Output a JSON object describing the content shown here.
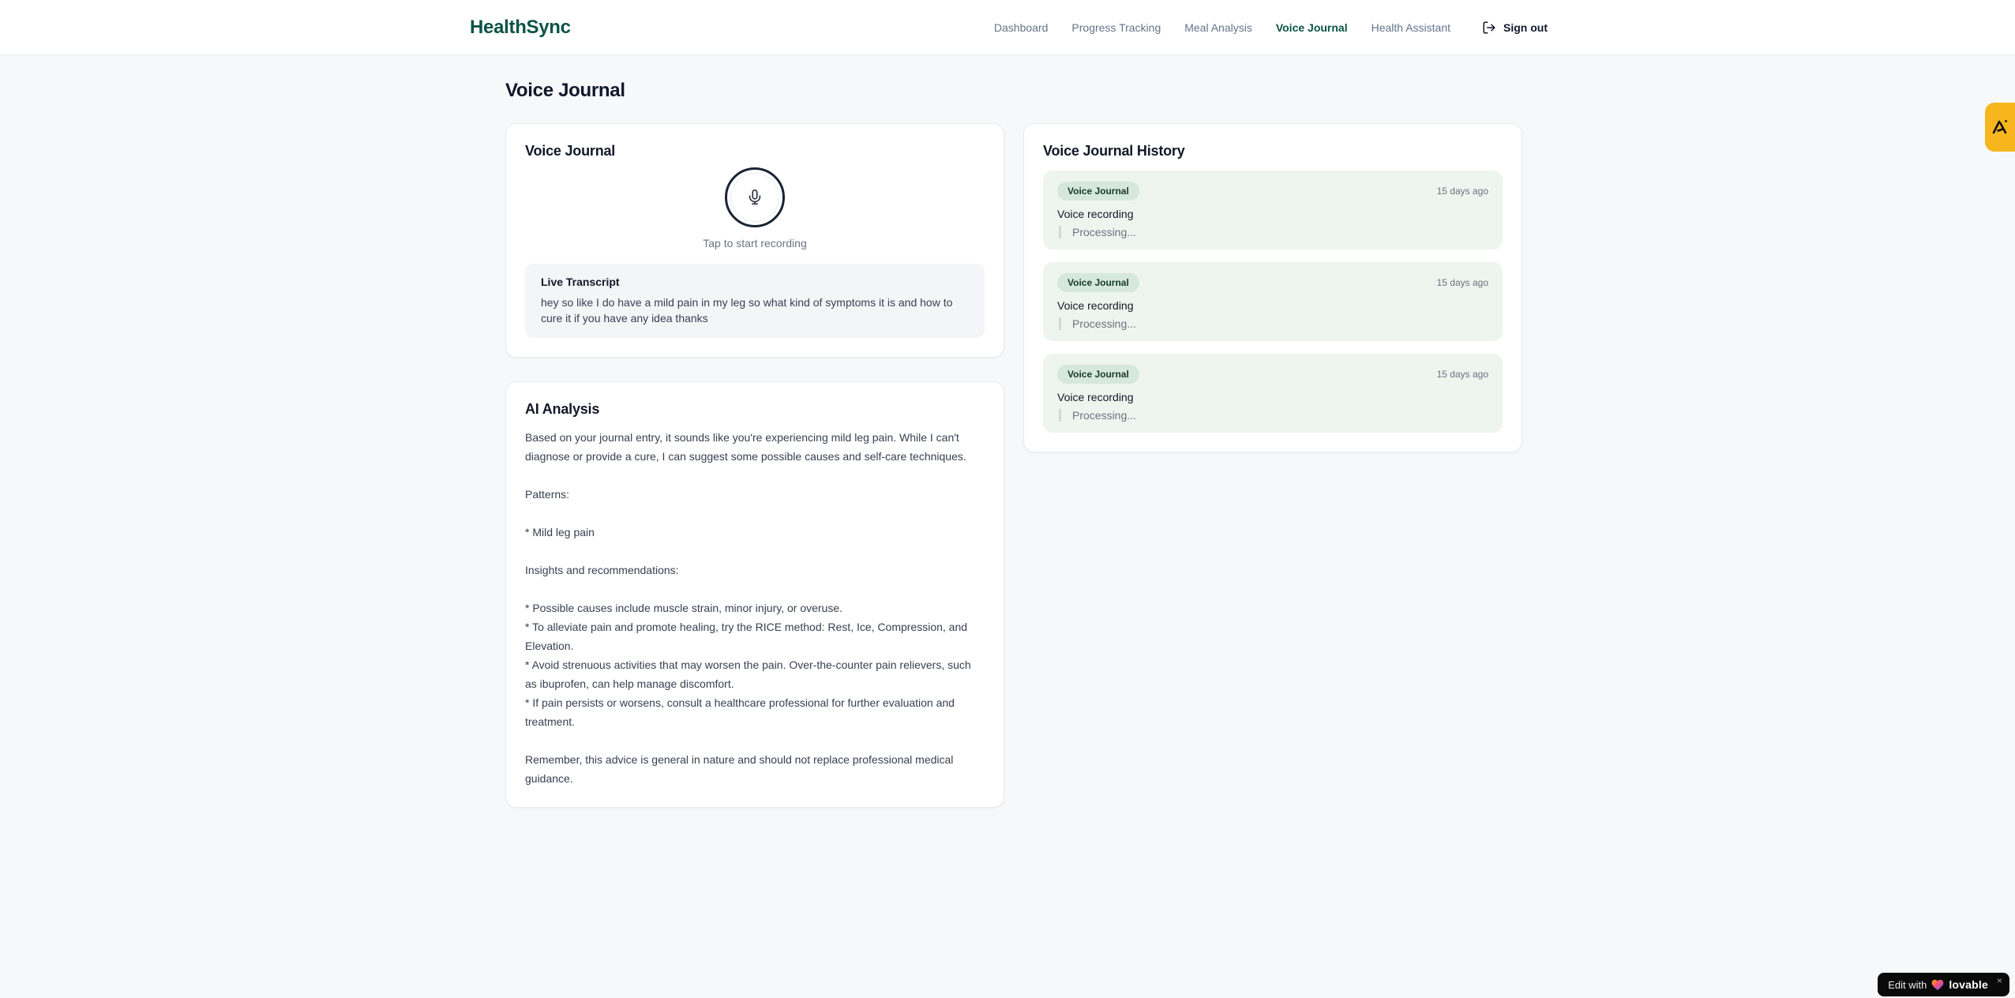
{
  "brand": {
    "name": "HealthSync",
    "accent_color": "#0b5345"
  },
  "nav": {
    "items": [
      {
        "label": "Dashboard",
        "active": false
      },
      {
        "label": "Progress Tracking",
        "active": false
      },
      {
        "label": "Meal Analysis",
        "active": false
      },
      {
        "label": "Voice Journal",
        "active": true
      },
      {
        "label": "Health Assistant",
        "active": false
      }
    ],
    "sign_out_label": "Sign out"
  },
  "page": {
    "title": "Voice Journal",
    "background_color": "#f6f8fa"
  },
  "recorder_card": {
    "title": "Voice Journal",
    "tap_hint": "Tap to start recording",
    "transcript_title": "Live Transcript",
    "transcript_text": "hey so like I do have a mild pain in my leg so what kind of symptoms it is and how to cure it if you have any idea thanks"
  },
  "analysis_card": {
    "title": "AI Analysis",
    "body": "Based on your journal entry, it sounds like you're experiencing mild leg pain. While I can't diagnose or provide a cure, I can suggest some possible causes and self-care techniques.\n\nPatterns:\n\n* Mild leg pain\n\nInsights and recommendations:\n\n* Possible causes include muscle strain, minor injury, or overuse.\n* To alleviate pain and promote healing, try the RICE method: Rest, Ice, Compression, and Elevation.\n* Avoid strenuous activities that may worsen the pain. Over-the-counter pain relievers, such as ibuprofen, can help manage discomfort.\n* If pain persists or worsens, consult a healthcare professional for further evaluation and treatment.\n\nRemember, this advice is general in nature and should not replace professional medical guidance."
  },
  "history_card": {
    "title": "Voice Journal History",
    "items": [
      {
        "badge": "Voice Journal",
        "time": "15 days ago",
        "title": "Voice recording",
        "status": "Processing..."
      },
      {
        "badge": "Voice Journal",
        "time": "15 days ago",
        "title": "Voice recording",
        "status": "Processing..."
      },
      {
        "badge": "Voice Journal",
        "time": "15 days ago",
        "title": "Voice recording",
        "status": "Processing..."
      }
    ],
    "item_bg_color": "#edf5ee",
    "badge_bg_color": "#d6e8da"
  },
  "floating": {
    "edit_with_label": "Edit with",
    "lovable_label": "lovable",
    "close_label": "×",
    "extension_badge_color": "#f7b61e"
  }
}
